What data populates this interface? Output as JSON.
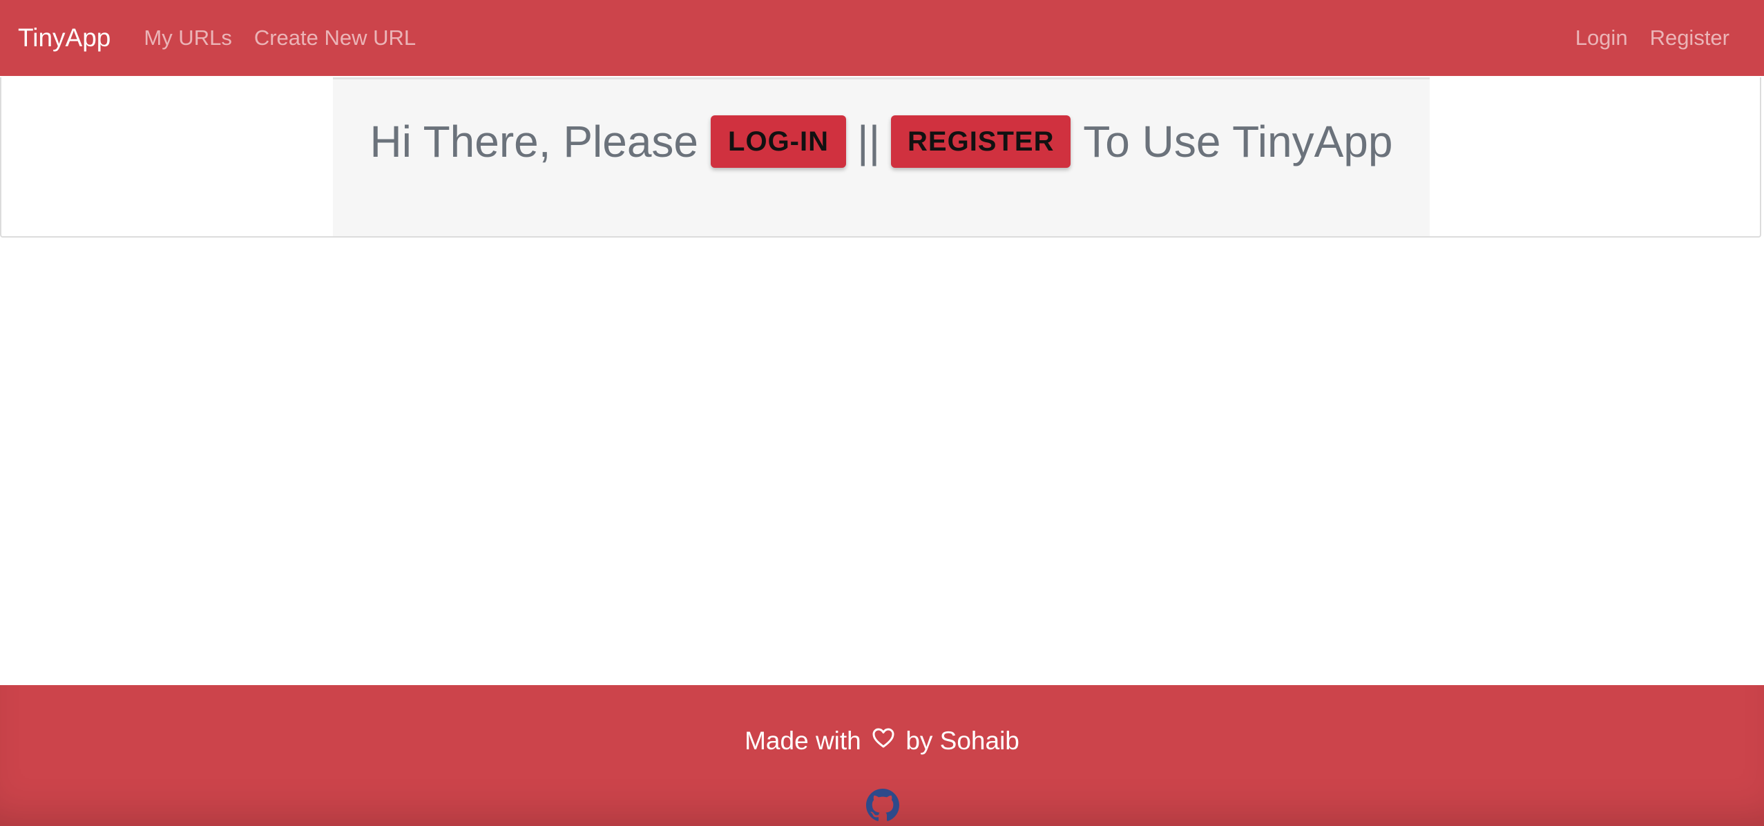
{
  "navbar": {
    "brand": "TinyApp",
    "left_links": [
      "My URLs",
      "Create New URL"
    ],
    "right_links": [
      "Login",
      "Register"
    ]
  },
  "jumbotron": {
    "text_before": "Hi There, Please",
    "login_button": "LOG-IN",
    "separator": "||",
    "register_button": "REGISTER",
    "text_after": "To Use TinyApp"
  },
  "footer": {
    "made_with": "Made with",
    "heart_icon": "heart-outline-icon",
    "by": "by Sohaib",
    "github_icon": "github-icon"
  },
  "colors": {
    "brand_red": "#cc444b",
    "button_red": "#d0313f",
    "heading_gray": "#6b727b",
    "github_blue": "#2e4a8a"
  }
}
